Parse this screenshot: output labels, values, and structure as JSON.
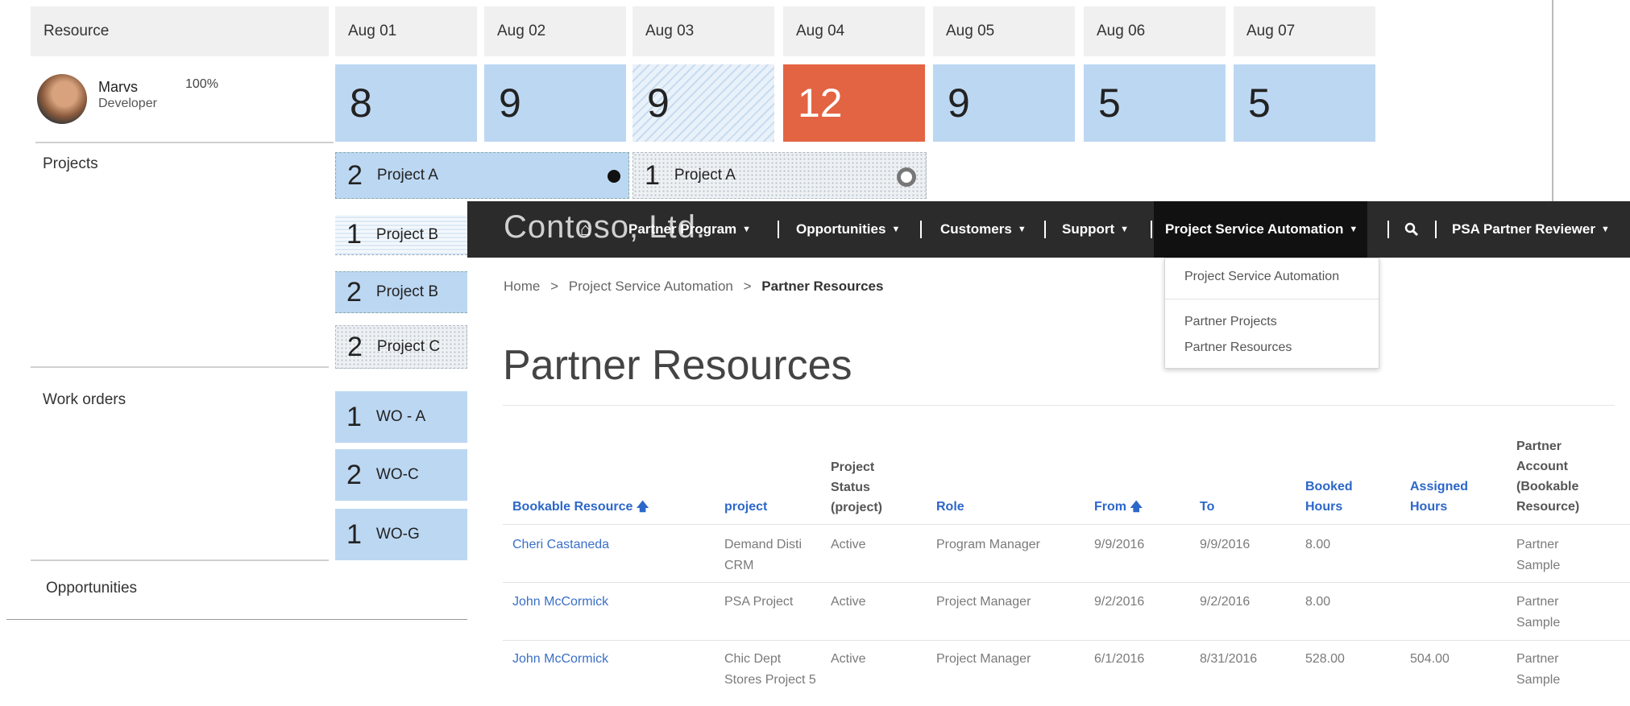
{
  "schedule": {
    "resource_header": "Resource",
    "days": [
      "Aug 01",
      "Aug 02",
      "Aug 03",
      "Aug 04",
      "Aug 05",
      "Aug 06",
      "Aug 07"
    ],
    "resource": {
      "name": "Marvs",
      "role": "Developer",
      "utilization": "100%"
    },
    "hours": [
      "8",
      "9",
      "9",
      "12",
      "9",
      "5",
      "5"
    ],
    "sections": {
      "projects": "Projects",
      "work_orders": "Work orders",
      "opportunities": "Opportunities"
    },
    "projects": [
      {
        "count": "2",
        "label": "Project A"
      },
      {
        "count": "1",
        "label": "Project A"
      },
      {
        "count": "1",
        "label": "Project B"
      },
      {
        "count": "2",
        "label": "Project B"
      },
      {
        "count": "2",
        "label": "Project C"
      }
    ],
    "work_orders": [
      {
        "count": "1",
        "label": "WO - A"
      },
      {
        "count": "2",
        "label": "WO-C"
      },
      {
        "count": "1",
        "label": "WO-G"
      }
    ],
    "colors": {
      "booked": "#bcd7f2",
      "overbooked": "#e36443"
    }
  },
  "portal": {
    "brand": "Contoso, Ltd.",
    "nav": [
      "Partner Program",
      "Opportunities",
      "Customers",
      "Support",
      "Project Service Automation",
      "PSA Partner Reviewer"
    ],
    "search_icon": "search-icon",
    "dropdown": [
      "Project Service Automation",
      "Partner Projects",
      "Partner Resources"
    ],
    "breadcrumb": {
      "home": "Home",
      "section": "Project Service Automation",
      "current": "Partner Resources",
      "separator": ">"
    },
    "page_title": "Partner Resources",
    "table": {
      "headers": [
        "Bookable Resource",
        "project",
        "Project Status (project)",
        "Role",
        "From",
        "To",
        "Booked Hours",
        "Assigned Hours",
        "Partner Account (Bookable Resource)"
      ],
      "rows": [
        [
          "Cheri Castaneda",
          "Demand Disti CRM",
          "Active",
          "Program Manager",
          "9/9/2016",
          "9/9/2016",
          "8.00",
          "",
          "Partner Sample"
        ],
        [
          "John McCormick",
          "PSA Project",
          "Active",
          "Project Manager",
          "9/2/2016",
          "9/2/2016",
          "8.00",
          "",
          "Partner Sample"
        ],
        [
          "John McCormick",
          "Chic Dept Stores Project 5",
          "Active",
          "Project Manager",
          "6/1/2016",
          "8/31/2016",
          "528.00",
          "504.00",
          "Partner Sample"
        ]
      ]
    }
  }
}
